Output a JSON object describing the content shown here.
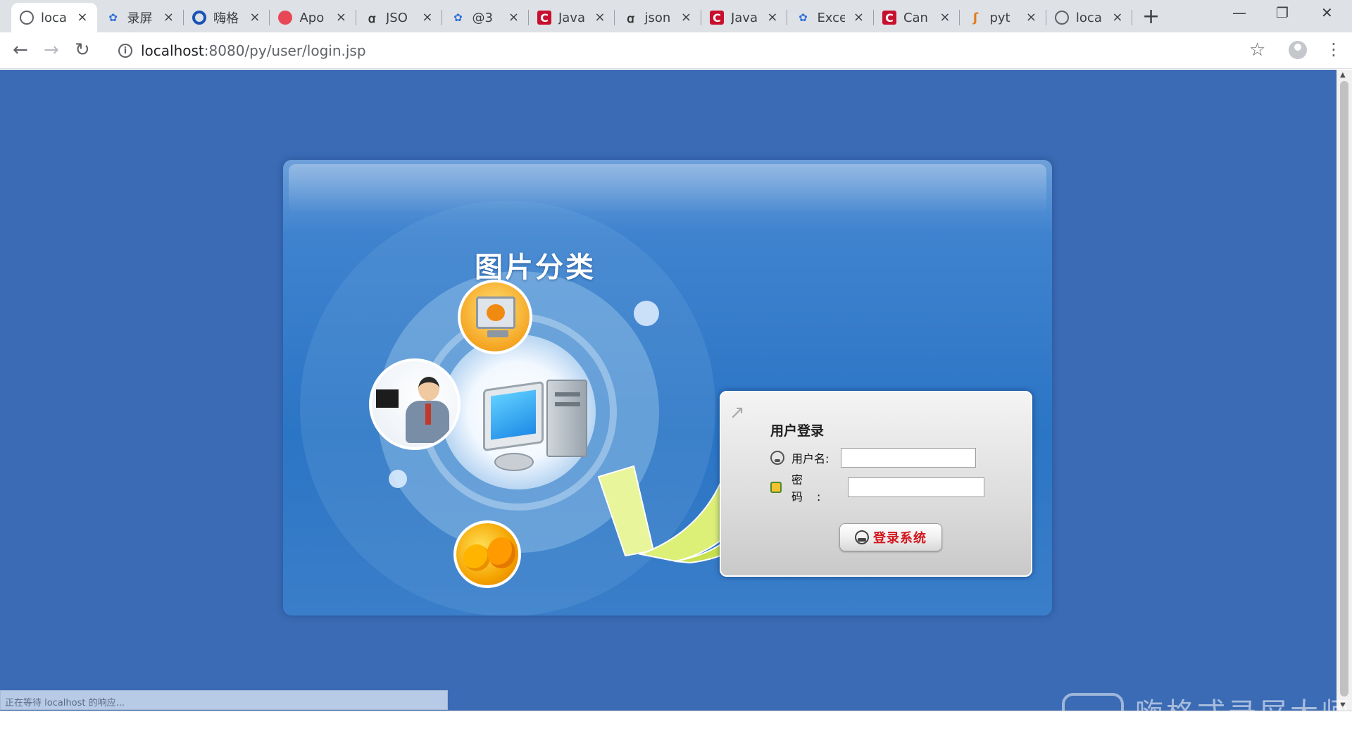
{
  "browser": {
    "tabs": [
      {
        "favicon": "globe-icon",
        "title": "loca",
        "active": true
      },
      {
        "favicon": "baidu-paw-icon",
        "title": "录屏"
      },
      {
        "favicon": "blue-ring-icon",
        "title": "嗨格"
      },
      {
        "favicon": "red-circle-icon",
        "title": "Apo"
      },
      {
        "favicon": "sos-icon",
        "title": "JSO"
      },
      {
        "favicon": "baidu-paw-icon",
        "title": "@3"
      },
      {
        "favicon": "csdn-c-icon",
        "title": "Java"
      },
      {
        "favicon": "sos-icon",
        "title": "json"
      },
      {
        "favicon": "csdn-c-icon",
        "title": "Java"
      },
      {
        "favicon": "baidu-paw-icon",
        "title": "Exce"
      },
      {
        "favicon": "csdn-c-icon",
        "title": "Can"
      },
      {
        "favicon": "python-icon",
        "title": "pyt"
      },
      {
        "favicon": "globe-icon",
        "title": "loca"
      }
    ],
    "url_host": "localhost",
    "url_path": ":8080/py/user/login.jsp",
    "icons": {
      "back": "←",
      "forward": "→",
      "reload": "↻",
      "info": "i",
      "star": "☆",
      "menu": "⋮",
      "close": "×",
      "new_tab": "+",
      "minimize": "—",
      "restore": "❐",
      "window_close": "✕"
    }
  },
  "page": {
    "site_title": "图片分类",
    "login": {
      "heading": "用户登录",
      "username_label": "用户名:",
      "username_value": "",
      "password_label": "密码:",
      "password_value": "",
      "submit_label": "登录系统"
    },
    "colors": {
      "background": "#3b6bb4",
      "panel": "#2b75c5",
      "submit_text": "#d4161d"
    }
  },
  "status_text": "正在等待 localhost 的响应...",
  "watermark": "嗨格式录屏大师"
}
